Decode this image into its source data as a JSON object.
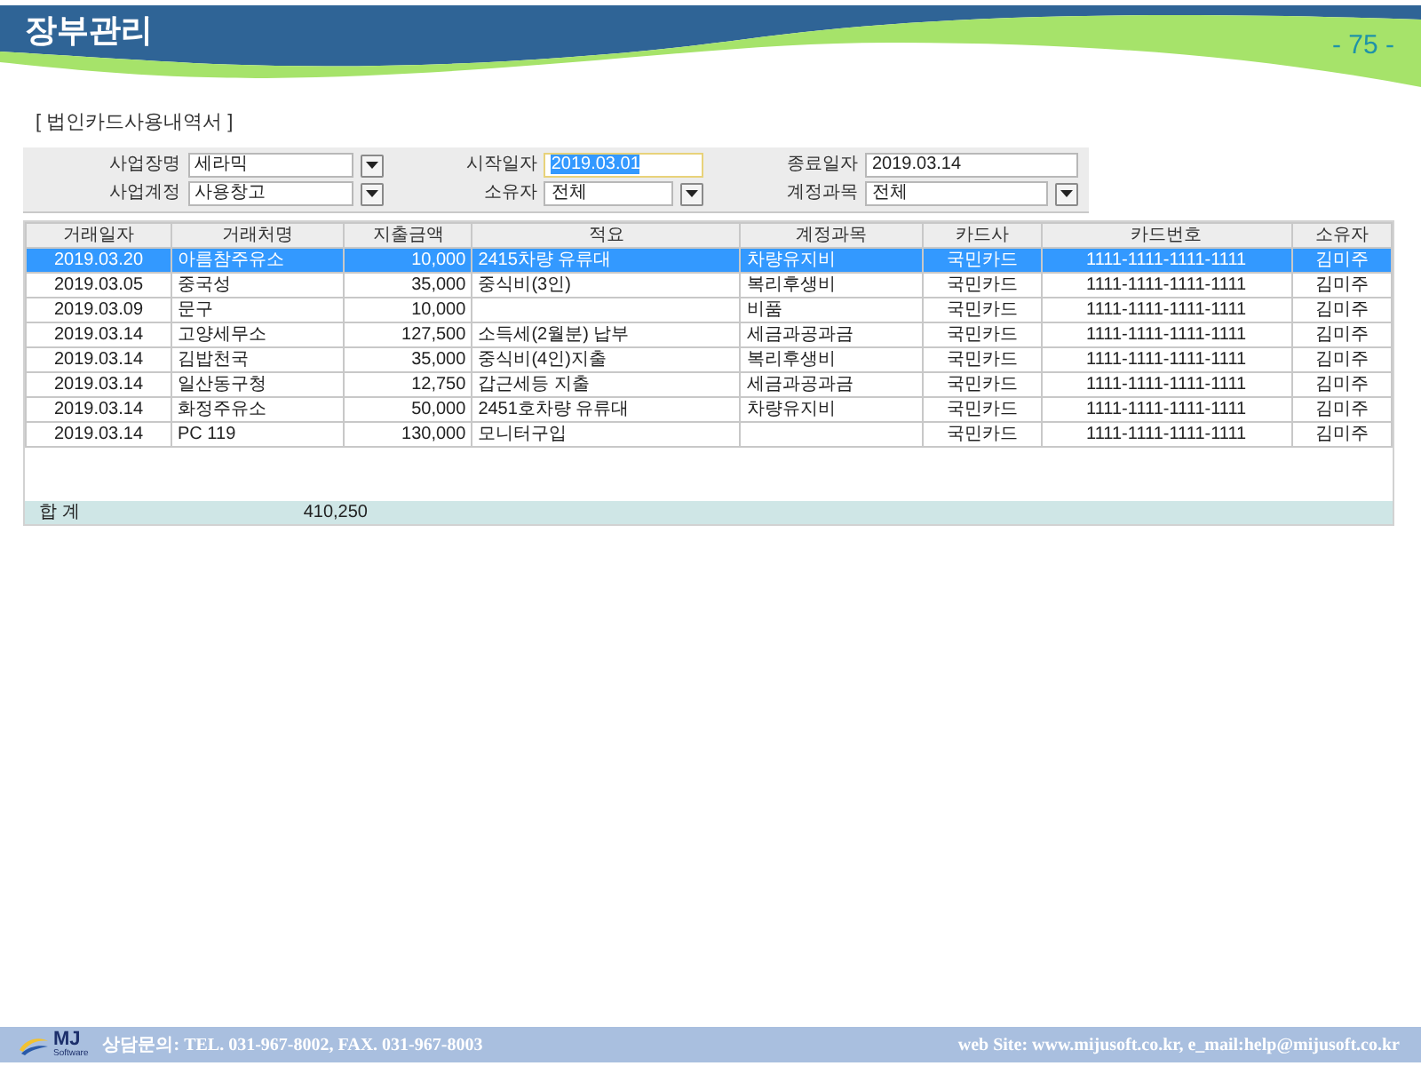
{
  "header": {
    "title": "장부관리",
    "page_number": "- 75 -"
  },
  "report_title": "[ 법인카드사용내역서 ]",
  "filters": [
    {
      "label": "사업장명",
      "value": "세라믹",
      "kind": "dropdown",
      "highlighted": false
    },
    {
      "label": "시작일자",
      "value": "2019.03.01",
      "kind": "date",
      "highlighted": true
    },
    {
      "label": "종료일자",
      "value": "2019.03.14",
      "kind": "date",
      "highlighted": false
    },
    {
      "label": "사업계정",
      "value": "사용창고",
      "kind": "dropdown",
      "highlighted": false
    },
    {
      "label": "소유자",
      "value": "전체",
      "kind": "dropdown",
      "highlighted": false
    },
    {
      "label": "계정과목",
      "value": "전체",
      "kind": "dropdown",
      "highlighted": false
    }
  ],
  "table": {
    "columns": [
      "거래일자",
      "거래처명",
      "지출금액",
      "적요",
      "계정과목",
      "카드사",
      "카드번호",
      "소유자"
    ],
    "rows": [
      {
        "selected": true,
        "date": "2019.03.20",
        "vendor": "아름참주유소",
        "amount": "10,000",
        "memo": "2415차량 유류대",
        "account": "차량유지비",
        "card_company": "국민카드",
        "card_number": "1111-1111-1111-1111",
        "owner": "김미주"
      },
      {
        "selected": false,
        "date": "2019.03.05",
        "vendor": "중국성",
        "amount": "35,000",
        "memo": "중식비(3인)",
        "account": "복리후생비",
        "card_company": "국민카드",
        "card_number": "1111-1111-1111-1111",
        "owner": "김미주"
      },
      {
        "selected": false,
        "date": "2019.03.09",
        "vendor": "문구",
        "amount": "10,000",
        "account": "비품",
        "card_company": "국민카드",
        "card_number": "1111-1111-1111-1111",
        "owner": "김미주"
      },
      {
        "selected": false,
        "date": "2019.03.14",
        "vendor": "고양세무소",
        "amount": "127,500",
        "memo": "소득세(2월분) 납부",
        "account": "세금과공과금",
        "card_company": "국민카드",
        "card_number": "1111-1111-1111-1111",
        "owner": "김미주"
      },
      {
        "selected": false,
        "date": "2019.03.14",
        "vendor": "김밥천국",
        "amount": "35,000",
        "memo": "중식비(4인)지출",
        "account": "복리후생비",
        "card_company": "국민카드",
        "card_number": "1111-1111-1111-1111",
        "owner": "김미주"
      },
      {
        "selected": false,
        "date": "2019.03.14",
        "vendor": "일산동구청",
        "amount": "12,750",
        "memo": "갑근세등 지출",
        "account": "세금과공과금",
        "card_company": "국민카드",
        "card_number": "1111-1111-1111-1111",
        "owner": "김미주"
      },
      {
        "selected": false,
        "date": "2019.03.14",
        "vendor": "화정주유소",
        "amount": "50,000",
        "memo": "2451호차량 유류대",
        "account": "차량유지비",
        "card_company": "국민카드",
        "card_number": "1111-1111-1111-1111",
        "owner": "김미주"
      },
      {
        "selected": false,
        "date": "2019.03.14",
        "vendor": "PC 119",
        "amount": "130,000",
        "memo": "모니터구입",
        "card_company": "국민카드",
        "card_number": "1111-1111-1111-1111",
        "owner": "김미주"
      }
    ],
    "total": {
      "label": "합 계",
      "amount": "410,250"
    }
  },
  "footer": {
    "logo_text": "MJ",
    "logo_subtext": "Software",
    "contact": "상담문의: TEL. 031-967-8002, FAX. 031-967-8003",
    "website": "web Site: www.mijusoft.co.kr, e_mail:help@mijusoft.co.kr"
  }
}
